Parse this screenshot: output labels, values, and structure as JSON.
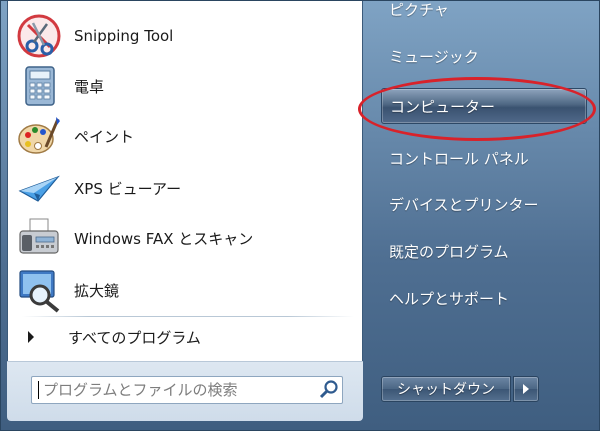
{
  "programs": [
    {
      "label": "Snipping Tool",
      "icon": "scissors-icon"
    },
    {
      "label": "電卓",
      "icon": "calculator-icon"
    },
    {
      "label": "ペイント",
      "icon": "paint-palette-icon"
    },
    {
      "label": "XPS ビューアー",
      "icon": "paper-plane-icon"
    },
    {
      "label": "Windows FAX とスキャン",
      "icon": "fax-machine-icon"
    },
    {
      "label": "拡大鏡",
      "icon": "magnifier-icon"
    }
  ],
  "all_programs": "すべてのプログラム",
  "search": {
    "placeholder": "プログラムとファイルの検索"
  },
  "right_menu": [
    {
      "label": "ピクチャ"
    },
    {
      "label": "ミュージック"
    },
    {
      "label": "コンピューター"
    },
    {
      "label": "コントロール パネル"
    },
    {
      "label": "デバイスとプリンター"
    },
    {
      "label": "既定のプログラム"
    },
    {
      "label": "ヘルプとサポート"
    }
  ],
  "shutdown": {
    "label": "シャットダウン"
  },
  "colors": {
    "highlight_ring": "#d8222a",
    "right_pane": "#4f6f92"
  }
}
